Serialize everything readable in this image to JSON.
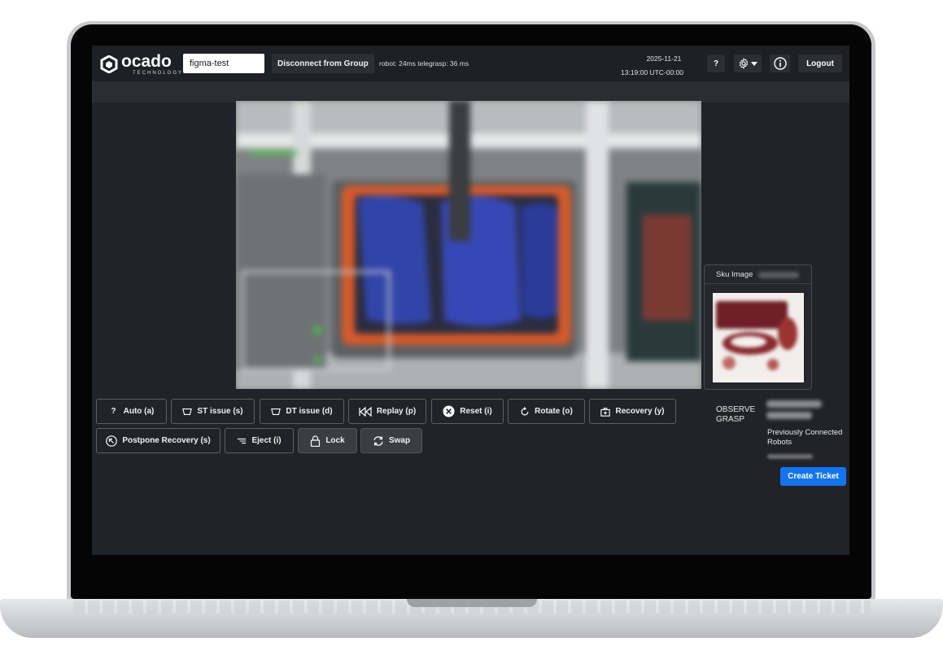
{
  "header": {
    "logo_word": "ocado",
    "logo_sub": "TECHNOLOGY",
    "group_input_value": "figma-test",
    "disconnect_label": "Disconnect from Group",
    "latency_text": "robot: 24ms  telegrasp: 36 ms",
    "date": "2025-11-21",
    "time": "13:19:00  UTC-00:00",
    "help_label": "?",
    "logout_label": "Logout"
  },
  "sku_panel": {
    "title": "Sku Image"
  },
  "actions": {
    "auto": "Auto (a)",
    "st_issue": "ST issue (s)",
    "dt_issue": "DT issue (d)",
    "replay": "Replay (p)",
    "reset": "Reset (i)",
    "rotate": "Rotate (o)",
    "recovery": "Recovery (y)",
    "postpone": "Postpone Recovery (s)",
    "eject": "Eject (i)",
    "lock": "Lock",
    "swap": "Swap"
  },
  "status": {
    "observe_line1": "OBSERVE",
    "observe_line2": "GRASP",
    "prev_connected": "Previously Connected Robots",
    "create_ticket": "Create Ticket"
  },
  "icons": {
    "logo": "ocado-hexagon-icon",
    "settings": "gear-icon",
    "info": "info-icon",
    "auto": "question-icon",
    "st_issue": "tray-icon",
    "dt_issue": "tray-icon",
    "replay": "rewind-icon",
    "reset": "close-circle-icon",
    "rotate": "rotate-icon",
    "recovery": "briefcase-plus-icon",
    "postpone": "arrow-up-left-circle-icon",
    "eject": "filter-lines-icon",
    "lock": "lock-icon",
    "swap": "swap-icon"
  },
  "colors": {
    "screen_bg": "#202327",
    "accent_blue": "#1474f0",
    "tote_orange": "#d45a2c",
    "bag_blue": "#3145a8"
  }
}
